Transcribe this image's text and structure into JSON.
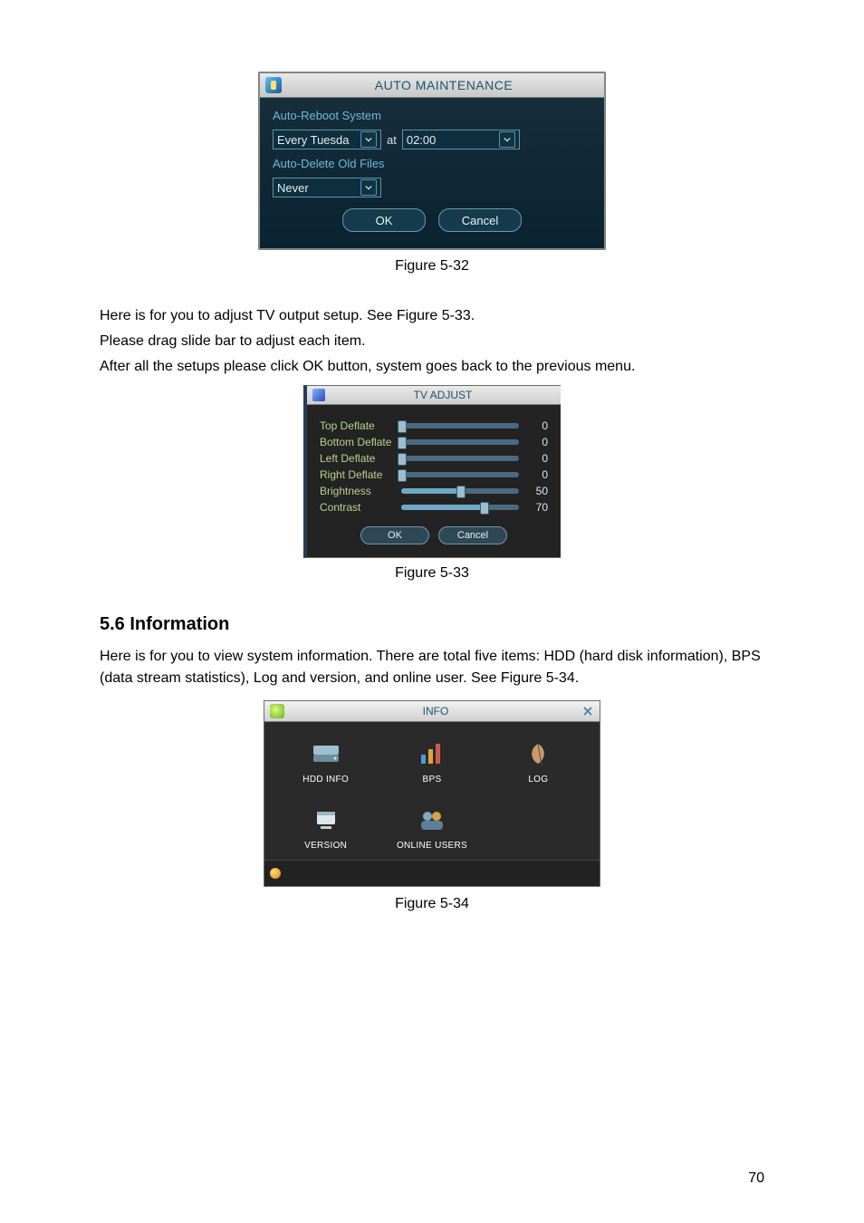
{
  "dlg1": {
    "title": "AUTO MAINTENANCE",
    "section_reboot": "Auto-Reboot System",
    "day_value": "Every Tuesda",
    "at_label": "at",
    "time_value": "02:00",
    "section_delete": "Auto-Delete Old Files",
    "never_value": "Never",
    "ok": "OK",
    "cancel": "Cancel"
  },
  "caption1": "Figure 5-32",
  "para": {
    "p1": "Here is for you to adjust TV output setup. See Figure 5-33.",
    "p2": "Please drag slide bar to adjust each item.",
    "p3": "After all the setups please click OK button, system goes back to the previous menu."
  },
  "dlg2": {
    "title": "TV ADJUST",
    "rows": [
      {
        "label": "Top Deflate",
        "value": "0",
        "pct": 0
      },
      {
        "label": "Bottom Deflate",
        "value": "0",
        "pct": 0
      },
      {
        "label": "Left Deflate",
        "value": "0",
        "pct": 0
      },
      {
        "label": "Right Deflate",
        "value": "0",
        "pct": 0
      },
      {
        "label": "Brightness",
        "value": "50",
        "pct": 50
      },
      {
        "label": "Contrast",
        "value": "70",
        "pct": 70
      }
    ],
    "ok": "OK",
    "cancel": "Cancel"
  },
  "caption2": "Figure 5-33",
  "heading": "5.6  Information",
  "info_text": "Here is for you to view system information. There are total five items: HDD (hard disk information), BPS (data stream statistics), Log and version, and online user. See Figure 5-34.",
  "dlg3": {
    "title": "INFO",
    "items": [
      {
        "key": "hdd",
        "label": "HDD INFO"
      },
      {
        "key": "bps",
        "label": "BPS"
      },
      {
        "key": "log",
        "label": "LOG"
      },
      {
        "key": "version",
        "label": "VERSION"
      },
      {
        "key": "online",
        "label": "ONLINE USERS"
      }
    ]
  },
  "caption3": "Figure 5-34",
  "page_number": "70"
}
